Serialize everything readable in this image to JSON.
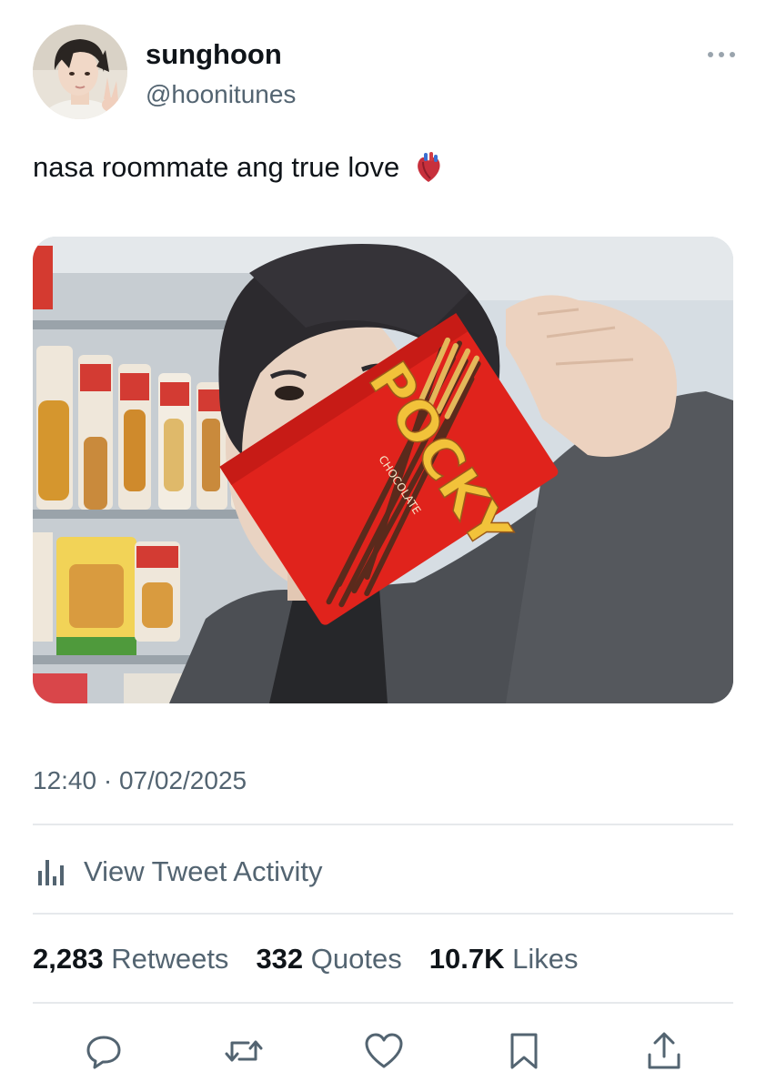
{
  "author": {
    "display_name": "sunghoon",
    "handle": "@hoonitunes",
    "avatar_icon": "user-avatar"
  },
  "tweet": {
    "text": "nasa roommate ang true love",
    "emoji_icon": "anatomical-heart-emoji",
    "timestamp": "12:40 · 07/02/2025"
  },
  "media": {
    "packaging_text": "POCKY",
    "packaging_subtext": "CHOCOLATE"
  },
  "activity": {
    "label": "View Tweet Activity",
    "icon": "bar-chart-icon"
  },
  "stats": {
    "retweets_count": "2,283",
    "retweets_label": "Retweets",
    "quotes_count": "332",
    "quotes_label": "Quotes",
    "likes_count": "10.7K",
    "likes_label": "Likes"
  },
  "actions": {
    "reply_icon": "reply-icon",
    "retweet_icon": "retweet-icon",
    "like_icon": "heart-icon",
    "bookmark_icon": "bookmark-icon",
    "share_icon": "share-icon"
  },
  "colors": {
    "text_primary": "#0f1419",
    "text_secondary": "#536471",
    "divider": "#e6e9ec",
    "pocky_red": "#e0231c",
    "pocky_yellow": "#f2c23a"
  }
}
